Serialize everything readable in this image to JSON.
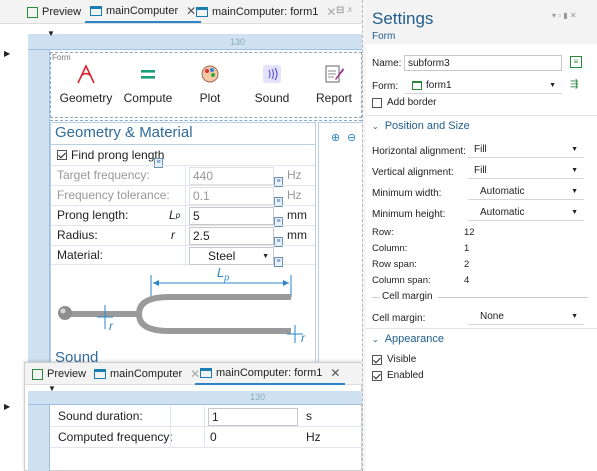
{
  "top_tabs": {
    "preview": "Preview",
    "main_computer": "mainComputer",
    "main_computer_form1": "mainComputer: form1"
  },
  "form_grid": {
    "ruler_130": "130",
    "form_label": "Form",
    "buttons": [
      "Geometry",
      "Compute",
      "Plot",
      "Sound",
      "Report"
    ]
  },
  "section": {
    "title": "Geometry & Material",
    "find_prong_length": "Find prong length",
    "next_section": "Sound"
  },
  "rows": [
    {
      "label": "Target frequency:",
      "symbol": "",
      "value": "440",
      "unit": "Hz",
      "disabled": true
    },
    {
      "label": "Frequency tolerance:",
      "symbol": "",
      "value": "0.1",
      "unit": "Hz",
      "disabled": true
    },
    {
      "label": "Prong length:",
      "symbol": "L",
      "sub": "p",
      "value": "5",
      "unit": "mm",
      "disabled": false
    },
    {
      "label": "Radius:",
      "symbol": "r",
      "sub": "",
      "value": "2.5",
      "unit": "mm",
      "disabled": false
    },
    {
      "label": "Material:",
      "symbol": "",
      "value": "Steel",
      "unit": "",
      "disabled": false
    }
  ],
  "diagram": {
    "lp_label": "L",
    "lp_sub": "p",
    "r_label": "r"
  },
  "bottom": {
    "tabs": {
      "preview": "Preview",
      "main_computer": "mainComputer",
      "form1": "mainComputer: form1"
    },
    "ruler_130": "130",
    "sound_duration_label": "Sound duration:",
    "sound_duration_value": "1",
    "sound_duration_unit": "s",
    "computed_freq_label": "Computed frequency:",
    "computed_freq_value": "0",
    "computed_freq_unit": "Hz"
  },
  "settings": {
    "title": "Settings",
    "subtitle": "Form",
    "name_label": "Name:",
    "name_value": "subform3",
    "form_label": "Form:",
    "form_value": "form1",
    "add_border": "Add border",
    "position_size": "Position and Size",
    "h_align_label": "Horizontal alignment:",
    "h_align_value": "Fill",
    "v_align_label": "Vertical alignment:",
    "v_align_value": "Fill",
    "min_width_label": "Minimum width:",
    "min_width_value": "Automatic",
    "min_height_label": "Minimum height:",
    "min_height_value": "Automatic",
    "row_label": "Row:",
    "row_value": "12",
    "column_label": "Column:",
    "column_value": "1",
    "row_span_label": "Row span:",
    "row_span_value": "2",
    "column_span_label": "Column span:",
    "column_span_value": "4",
    "cell_margin_group": "Cell margin",
    "cell_margin_label": "Cell margin:",
    "cell_margin_value": "None",
    "appearance": "Appearance",
    "visible": "Visible",
    "enabled": "Enabled"
  },
  "colors": {
    "accent": "#1f5d8e",
    "grid_blue": "#cfe1f1",
    "tab_underline": "#2a86c8"
  }
}
